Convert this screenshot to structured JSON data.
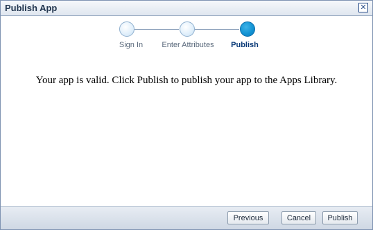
{
  "dialog": {
    "title": "Publish App",
    "close_icon": "close-icon"
  },
  "train": {
    "steps": [
      {
        "label": "Sign In",
        "state": "visited"
      },
      {
        "label": "Enter Attributes",
        "state": "visited"
      },
      {
        "label": "Publish",
        "state": "current"
      }
    ]
  },
  "message": "Your app is valid. Click Publish to publish your app to the Apps Library.",
  "buttons": {
    "previous": "Previous",
    "cancel": "Cancel",
    "publish": "Publish"
  },
  "colors": {
    "current_step": "#1394d4",
    "visited_step": "#e2f0fb",
    "title_text": "#22364f"
  }
}
